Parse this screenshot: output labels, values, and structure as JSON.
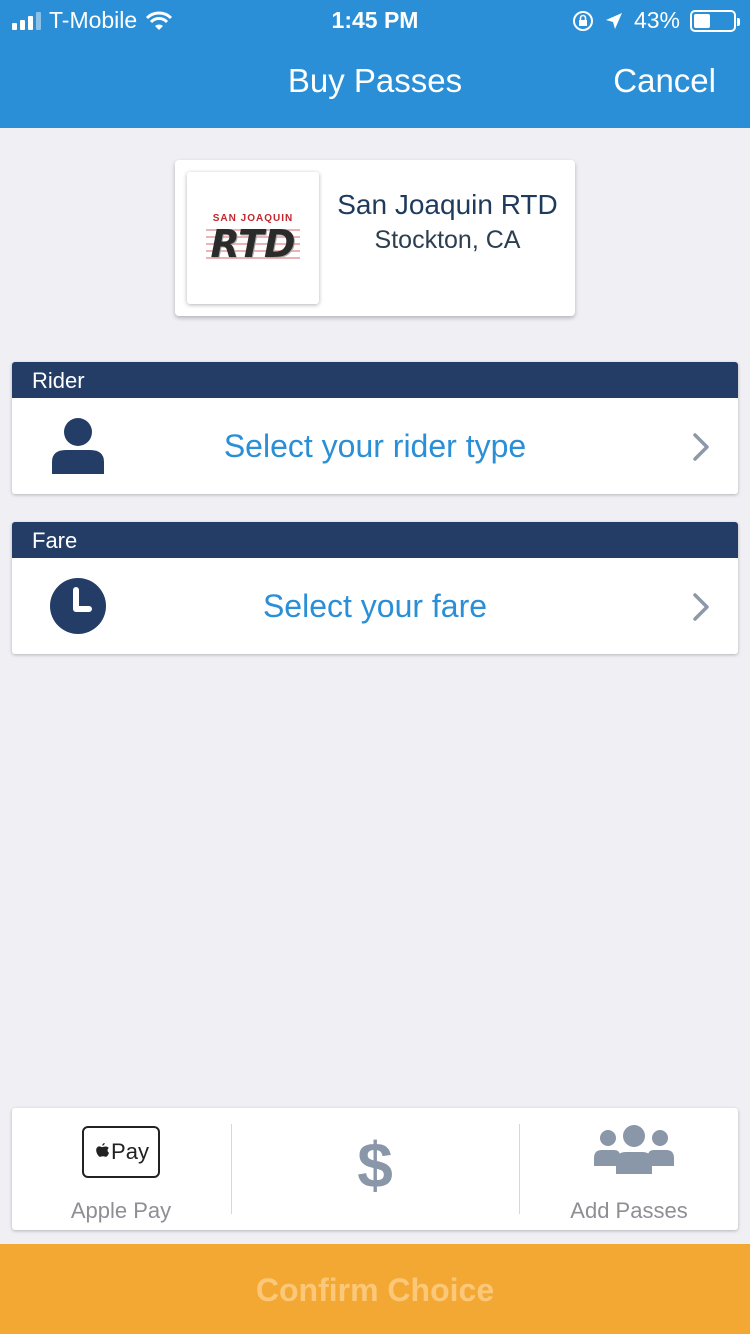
{
  "status_bar": {
    "carrier": "T-Mobile",
    "time": "1:45 PM",
    "battery": "43%",
    "battery_level": 0.43,
    "signal_bars_filled": 3,
    "signal_bars_total": 4,
    "icons": [
      "wifi-icon",
      "orientation-lock-icon",
      "location-arrow-icon",
      "battery-icon"
    ]
  },
  "nav": {
    "title": "Buy Passes",
    "cancel_label": "Cancel"
  },
  "agency": {
    "logo_top_text": "SAN JOAQUIN",
    "logo_main_text": "RTD",
    "name": "San Joaquin RTD",
    "location": "Stockton, CA"
  },
  "rider": {
    "header": "Rider",
    "label": "Select your rider type",
    "icon": "person-icon"
  },
  "fare": {
    "header": "Fare",
    "label": "Select your fare",
    "icon": "clock-icon"
  },
  "tabbar": {
    "apple_pay_mark": "Pay",
    "apple_pay_label": "Apple Pay",
    "middle_icon": "dollar-icon",
    "middle_glyph": "$",
    "add_passes_label": "Add Passes",
    "add_passes_icon": "group-icon"
  },
  "confirm": {
    "label": "Confirm Choice"
  },
  "colors": {
    "nav_blue": "#2a8fd6",
    "header_navy": "#233d66",
    "link_blue": "#2a8fd6",
    "confirm_orange": "#f4a834",
    "background": "#efeff4"
  }
}
